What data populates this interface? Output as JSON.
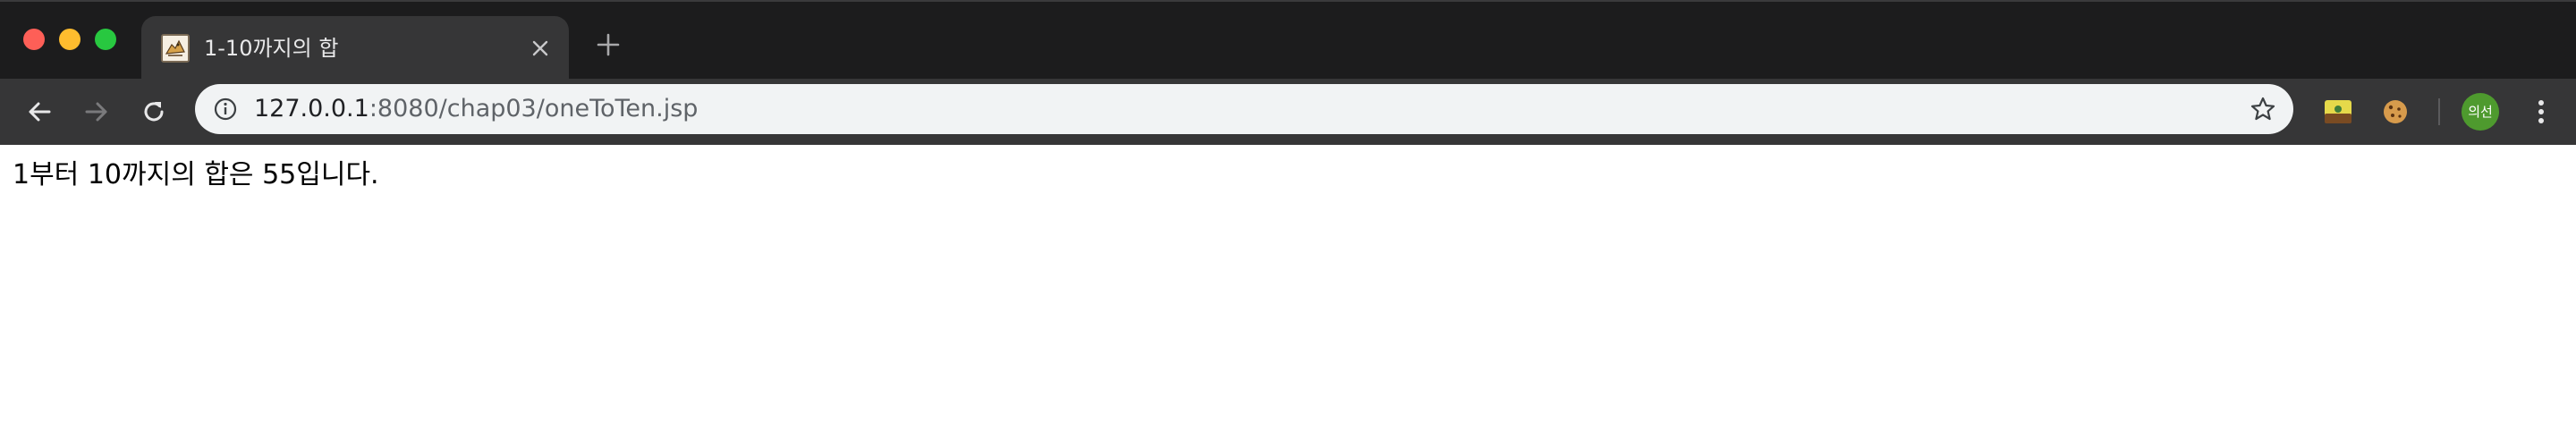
{
  "window": {
    "controls": {
      "close_color": "#fe5f57",
      "minimize_color": "#febc2e",
      "maximize_color": "#28c840"
    }
  },
  "tab": {
    "title": "1-10까지의 합",
    "favicon": "tomcat-favicon-icon",
    "close_icon": "close-icon"
  },
  "new_tab": {
    "icon": "plus-icon"
  },
  "toolbar": {
    "back_icon": "arrow-left-icon",
    "forward_icon": "arrow-right-icon",
    "reload_icon": "reload-icon",
    "extensions": [
      "extension-icon",
      "cookie-icon"
    ],
    "profile_avatar_label": "의선",
    "menu_icon": "more-vertical-icon"
  },
  "omnibox": {
    "info_icon": "info-icon",
    "url_host": "127.0.0.1",
    "url_rest": ":8080/chap03/oneToTen.jsp",
    "bookmark_icon": "star-icon"
  },
  "page": {
    "text": "1부터 10까지의 합은 55입니다."
  },
  "colors": {
    "tabstrip_bg": "#1c1c1d",
    "toolbar_bg": "#363637",
    "omnibox_bg": "#f1f3f4",
    "avatar_bg": "#4e9a2e"
  }
}
